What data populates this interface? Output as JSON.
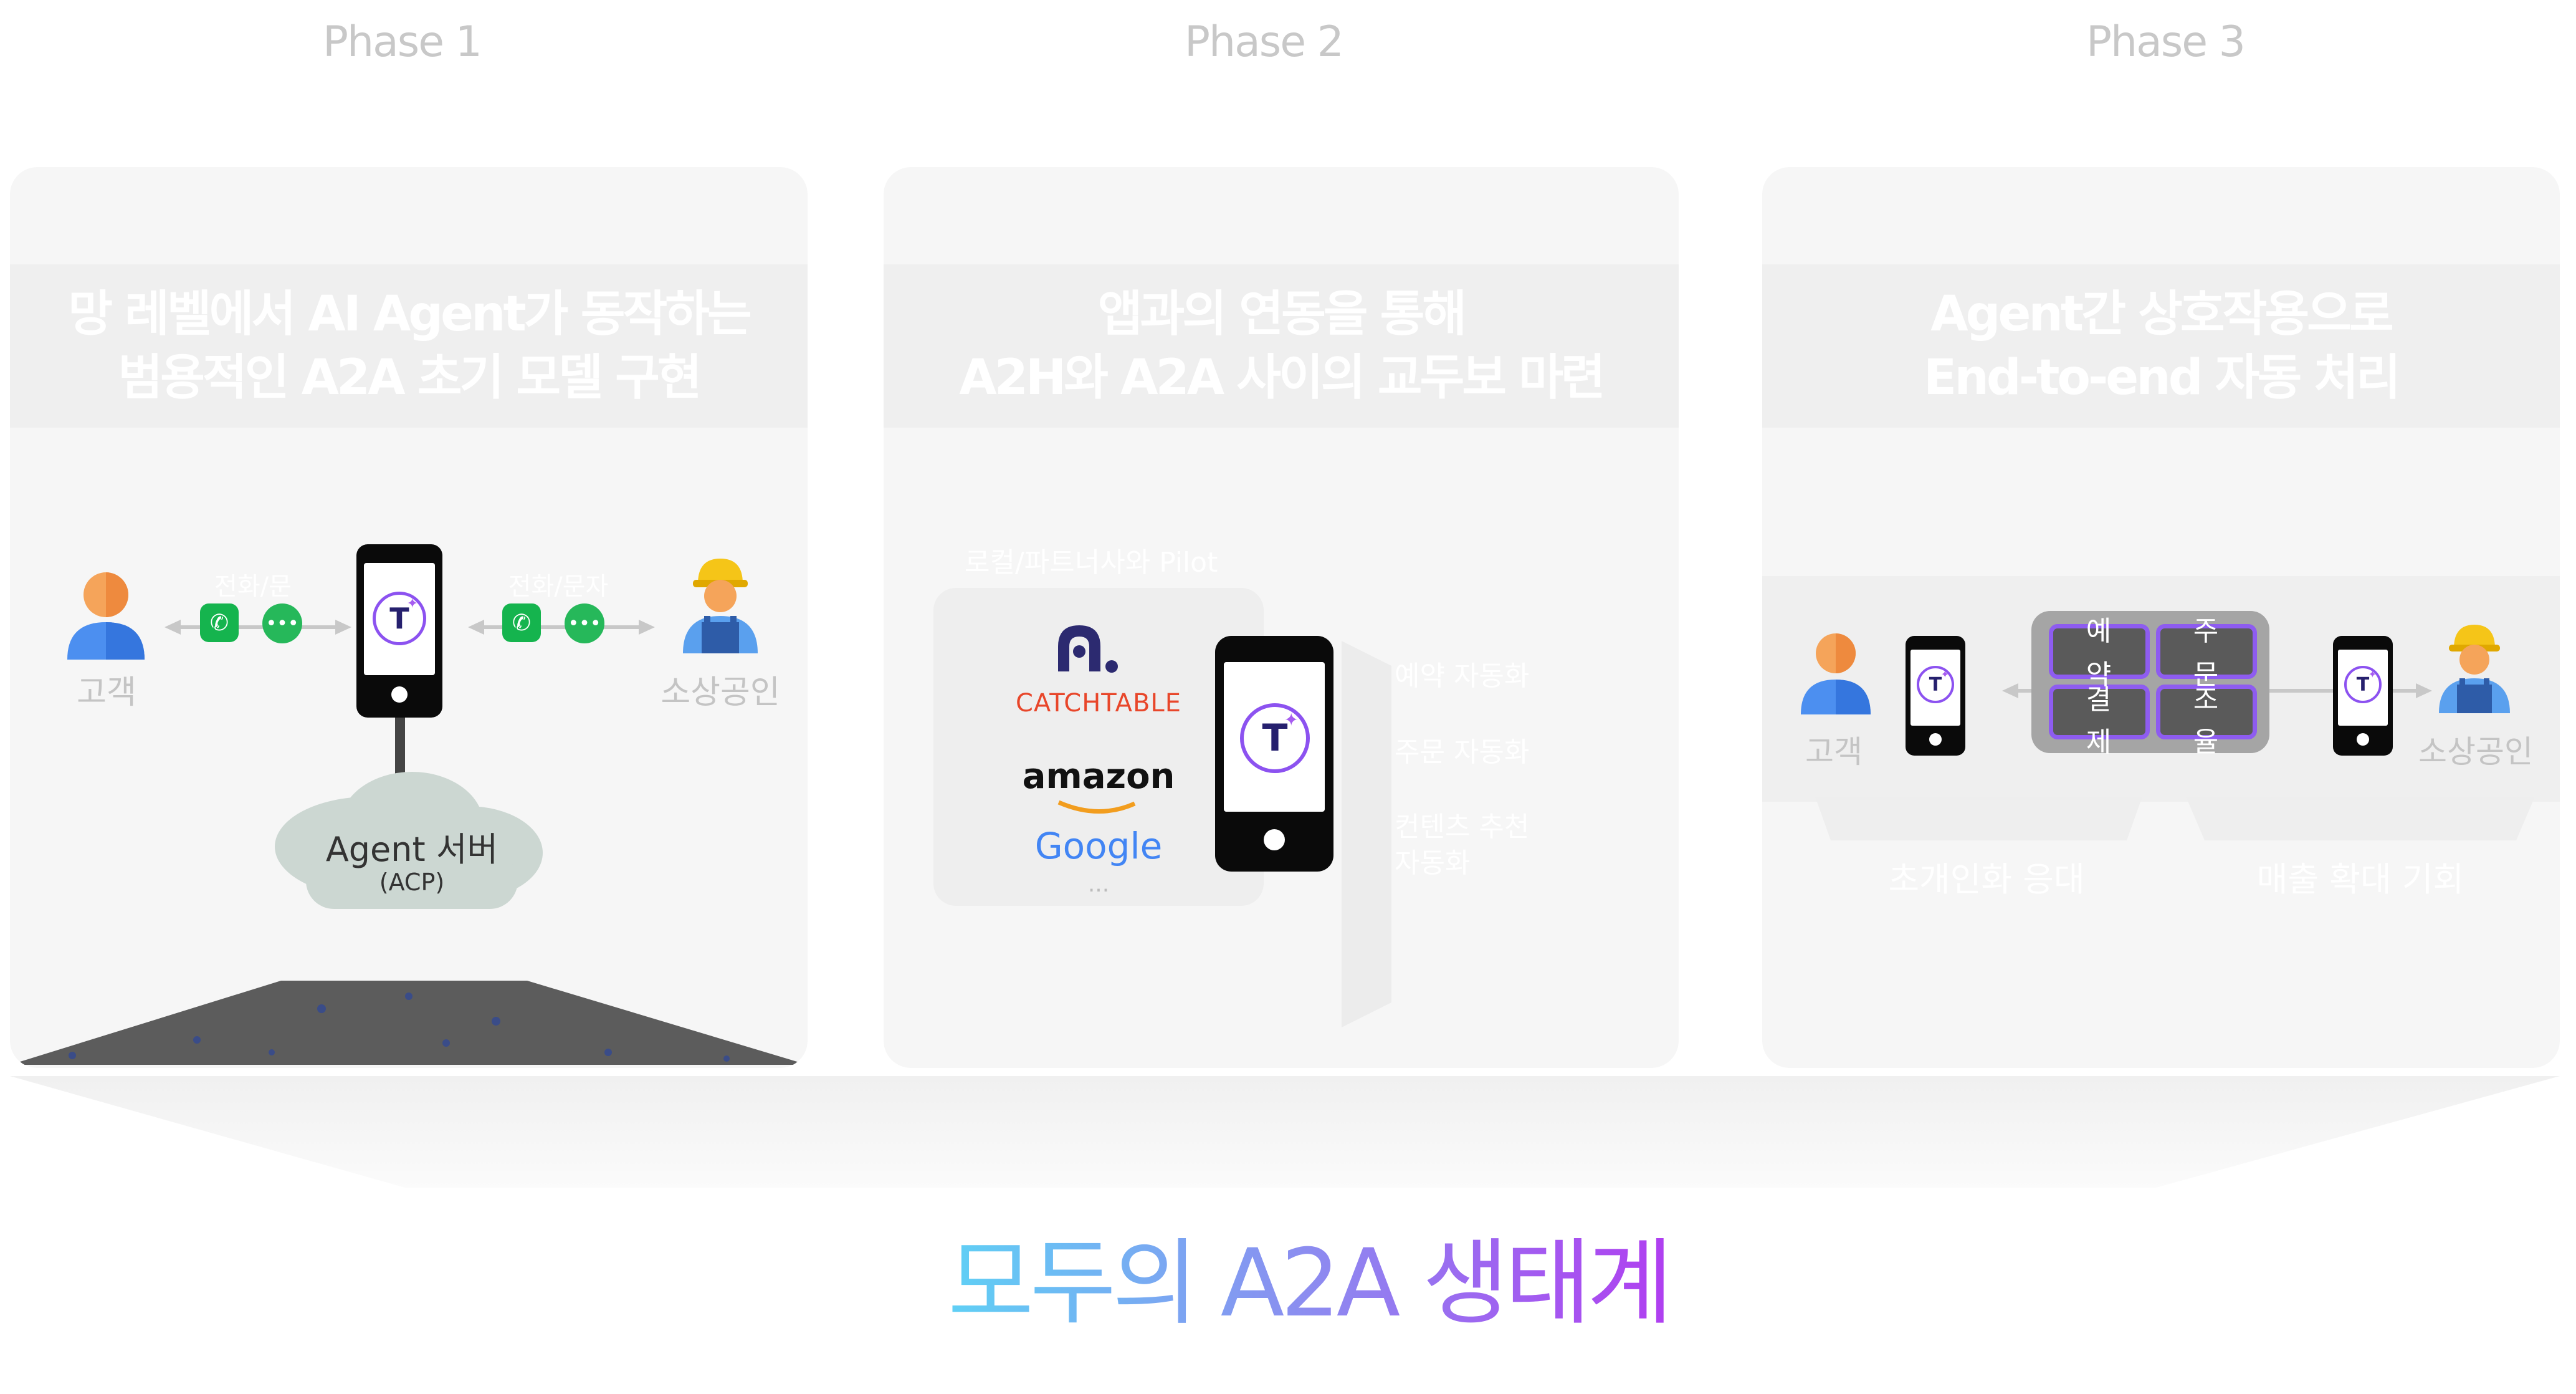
{
  "phases": [
    {
      "label": "Phase 1",
      "title_line1": "망 레벨에서 AI Agent가 동작하는",
      "title_line2": "범용적인 A2A 초기 모델 구현"
    },
    {
      "label": "Phase 2",
      "title_line1": "앱과의 연동을 통해",
      "title_line2": "A2H와 A2A 사이의 교두보 마련"
    },
    {
      "label": "Phase 3",
      "title_line1": "Agent간 상호작용으로",
      "title_line2": "End-to-end 자동 처리"
    }
  ],
  "phase1": {
    "customer": "고객",
    "merchant": "소상공인",
    "left_channel": "전화/문",
    "right_channel": "전화/문자",
    "server_name": "Agent 서버",
    "server_sub": "(ACP)"
  },
  "phase2": {
    "pilot_title": "로컬/파트너사와 Pilot",
    "partners": [
      "CATCHTABLE",
      "amazon",
      "Google"
    ],
    "partners_more": "...",
    "features": [
      "예약 자동화",
      "주문 자동화",
      "컨텐츠 추천",
      "자동화"
    ]
  },
  "phase3": {
    "customer": "고객",
    "merchant": "소상공인",
    "left_chars": [
      "예",
      "약",
      "결",
      "제"
    ],
    "right_chars": [
      "주",
      "문",
      "조",
      "율"
    ],
    "bottom_left": "초개인화 응대",
    "bottom_right": "매출 확대 기회"
  },
  "footer": {
    "title": "모두의 A2A 생태계"
  },
  "colors": {
    "accent_purple": "#a146f5",
    "accent_cyan": "#5fd0f5",
    "green": "#1db954",
    "panel": "#f6f6f6"
  }
}
